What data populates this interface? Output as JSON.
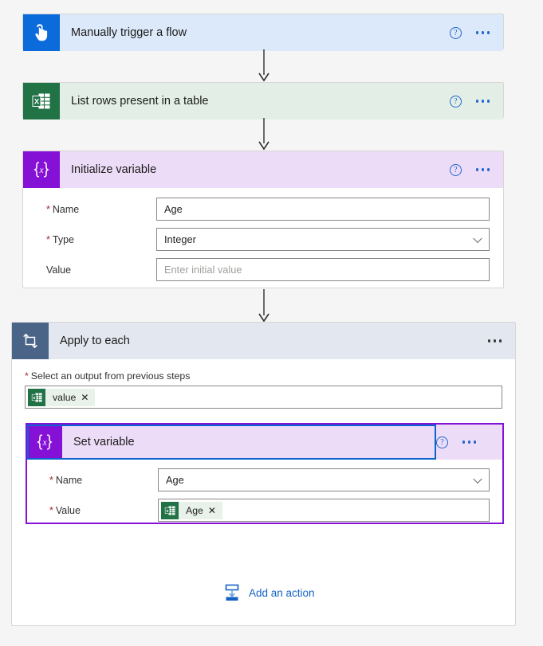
{
  "flow": {
    "steps": [
      {
        "id": "manual-trigger",
        "title": "Manually trigger a flow",
        "icon": "touch-hand-icon",
        "icon_bg": "#0b6bdb",
        "header_bg": "#dce9fa",
        "help_label": "?",
        "more_label": "More commands"
      },
      {
        "id": "list-rows",
        "title": "List rows present in a table",
        "icon": "excel-icon",
        "icon_bg": "#217346",
        "header_bg": "#e3efe6",
        "help_label": "?",
        "more_label": "More commands"
      },
      {
        "id": "initialize-variable",
        "title": "Initialize variable",
        "icon": "variable-braces-icon",
        "icon_bg": "#8611d6",
        "header_bg": "#ecdcf8",
        "help_label": "?",
        "more_label": "More commands",
        "fields": [
          {
            "label": "Name",
            "required": true,
            "value": "Age",
            "placeholder": "",
            "type": "text"
          },
          {
            "label": "Type",
            "required": true,
            "value": "Integer",
            "placeholder": "",
            "type": "select"
          },
          {
            "label": "Value",
            "required": false,
            "value": "",
            "placeholder": "Enter initial value",
            "type": "text"
          }
        ]
      }
    ],
    "apply_to_each": {
      "title": "Apply to each",
      "icon": "loop-repeat-icon",
      "icon_bg": "#4a6488",
      "header_bg": "#e3e7ef",
      "more_label": "More commands",
      "select_output_label": "Select an output from previous steps",
      "select_output_required": true,
      "token": {
        "text": "value",
        "icon": "excel-icon",
        "remove_label": "✕"
      },
      "nested_action": {
        "title": "Set variable",
        "icon": "variable-braces-icon",
        "icon_bg": "#8611d6",
        "header_bg": "#ecdcf8",
        "selected": true,
        "selection_color": "#8611d6",
        "focus_color": "#0b63ce",
        "help_label": "?",
        "more_label": "More commands",
        "fields": [
          {
            "label": "Name",
            "required": true,
            "value": "Age",
            "type": "select"
          },
          {
            "label": "Value",
            "required": true,
            "type": "token",
            "token": {
              "text": "Age",
              "icon": "excel-icon",
              "remove_label": "✕"
            }
          }
        ]
      },
      "add_action": {
        "label": "Add an action",
        "icon": "add-action-insert-icon",
        "color": "#1462c4"
      }
    }
  }
}
